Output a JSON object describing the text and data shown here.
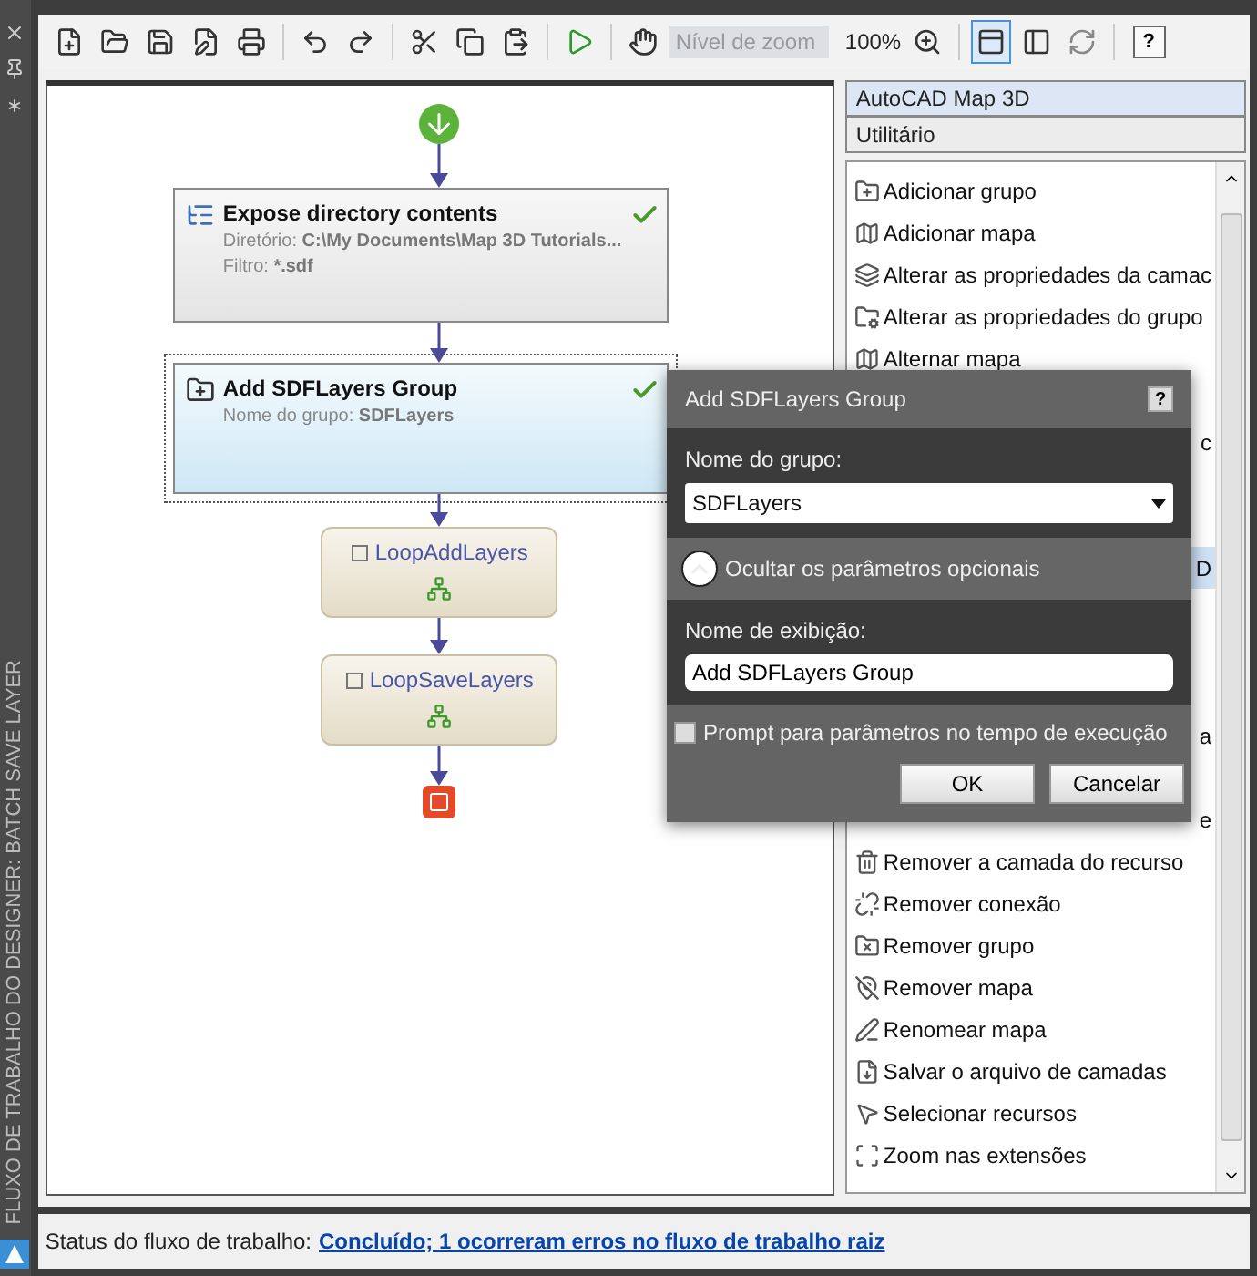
{
  "side_strip": {
    "title": "FLUXO DE TRABALHO DO DESIGNER: BATCH SAVE LAYER"
  },
  "toolbar": {
    "zoom_field": {
      "placeholder": "Nível de zoom"
    },
    "zoom_reading": "100%",
    "view_toggles": [
      {
        "selected": true
      },
      {
        "selected": false
      }
    ],
    "help": "?"
  },
  "workflow": {
    "nodes": [
      {
        "kind": "start"
      },
      {
        "kind": "activity",
        "title": "Expose directory contents",
        "valid": true,
        "selected": false,
        "fields": [
          {
            "label": "Diretório:",
            "value": "C:\\My Documents\\Map 3D Tutorials..."
          },
          {
            "label": "Filtro:",
            "value": "*.sdf"
          }
        ]
      },
      {
        "kind": "activity",
        "title": "Add SDFLayers Group",
        "valid": true,
        "selected": true,
        "fields": [
          {
            "label": "Nome do grupo:",
            "value": "SDFLayers"
          }
        ]
      },
      {
        "kind": "loop",
        "title": "LoopAddLayers"
      },
      {
        "kind": "loop",
        "title": "LoopSaveLayers"
      },
      {
        "kind": "end"
      }
    ]
  },
  "palette": {
    "header": "AutoCAD Map 3D",
    "category": "Utilitário",
    "items": [
      {
        "kind": "item",
        "label": "Adicionar grupo",
        "selected": false
      },
      {
        "kind": "item",
        "label": "Adicionar mapa",
        "selected": false
      },
      {
        "kind": "item",
        "label": "Alterar as propriedades da camac",
        "selected": false
      },
      {
        "kind": "item",
        "label": "Alterar as propriedades do grupo",
        "selected": false
      },
      {
        "kind": "item",
        "label": "Alternar mapa",
        "selected": false
      },
      {
        "kind": "covered",
        "selected": false
      },
      {
        "kind": "covered",
        "label": "c",
        "selected": false
      },
      {
        "kind": "covered",
        "selected": false
      },
      {
        "kind": "covered",
        "selected": false
      },
      {
        "kind": "covered",
        "label": "D",
        "selected": true
      },
      {
        "kind": "covered",
        "selected": false
      },
      {
        "kind": "covered",
        "selected": false
      },
      {
        "kind": "covered",
        "selected": false
      },
      {
        "kind": "covered",
        "label": "a",
        "selected": false
      },
      {
        "kind": "covered",
        "selected": false
      },
      {
        "kind": "covered",
        "label": "e",
        "selected": false
      },
      {
        "kind": "item",
        "label": "Remover a camada do recurso",
        "selected": false
      },
      {
        "kind": "item",
        "label": "Remover conexão",
        "selected": false
      },
      {
        "kind": "item",
        "label": "Remover grupo",
        "selected": false
      },
      {
        "kind": "item",
        "label": "Remover mapa",
        "selected": false
      },
      {
        "kind": "item",
        "label": "Renomear mapa",
        "selected": false
      },
      {
        "kind": "item",
        "label": "Salvar o arquivo de camadas",
        "selected": false
      },
      {
        "kind": "item",
        "label": "Selecionar recursos",
        "selected": false
      },
      {
        "kind": "item",
        "label": "Zoom nas extensões",
        "selected": false
      }
    ]
  },
  "dialog": {
    "title": "Add SDFLayers Group",
    "help": "?",
    "group_label": "Nome do grupo:",
    "group_value": "SDFLayers",
    "optional_toggle": {
      "label": "Ocultar os parâmetros opcionais",
      "expanded": true
    },
    "display_label": "Nome de exibição:",
    "display_value": "Add SDFLayers Group",
    "prompt_checkbox": {
      "label": "Prompt para parâmetros no tempo de execução",
      "checked": false
    },
    "buttons": [
      "OK",
      "Cancelar"
    ]
  },
  "status_bar": {
    "label": "Status do fluxo de trabalho:",
    "link": "Concluído; 1 ocorreram erros no fluxo de trabalho raiz"
  }
}
